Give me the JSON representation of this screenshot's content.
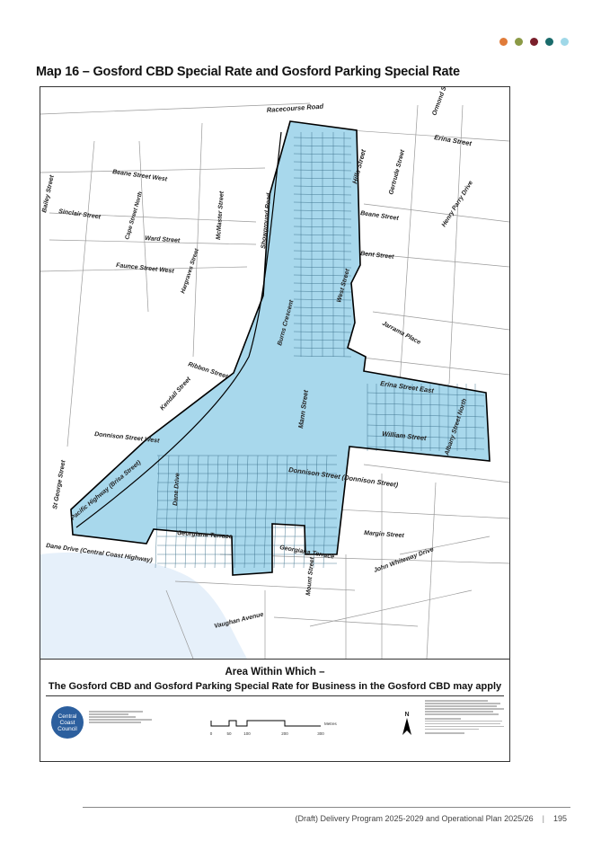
{
  "colors": {
    "dots": [
      "#e07b39",
      "#8b9a46",
      "#7a1f2b",
      "#1a6b6b",
      "#9fd8e8"
    ],
    "rate_area": "#a8d8ec",
    "boundary": "#000000",
    "water": "#e6f0fa",
    "council": "#2c5f9e"
  },
  "map": {
    "title": "Map 16 – Gosford CBD Special Rate and Gosford Parking Special Rate",
    "streets": [
      {
        "id": "racecourse-road",
        "label": "Racecourse Road"
      },
      {
        "id": "erina-street",
        "label": "Erina Street"
      },
      {
        "id": "ormond-street",
        "label": "Ormond Street"
      },
      {
        "id": "hills-street",
        "label": "Hills Street"
      },
      {
        "id": "beane-street-west",
        "label": "Beane Street West"
      },
      {
        "id": "bailey-street",
        "label": "Bailey Street"
      },
      {
        "id": "sinclair-street",
        "label": "Sinclair Street"
      },
      {
        "id": "cape-street-north",
        "label": "Cape Street North"
      },
      {
        "id": "ward-street",
        "label": "Ward Street"
      },
      {
        "id": "faunce-street-west",
        "label": "Faunce Street West"
      },
      {
        "id": "mcmaster-street",
        "label": "McMaster Street"
      },
      {
        "id": "showground-road",
        "label": "Showground Road"
      },
      {
        "id": "hargraves-street",
        "label": "Hargraves Street"
      },
      {
        "id": "gertrude-street",
        "label": "Gertrude Street"
      },
      {
        "id": "henry-parry-drive",
        "label": "Henry Parry Drive"
      },
      {
        "id": "beane-street",
        "label": "Beane Street"
      },
      {
        "id": "bent-street",
        "label": "Bent Street"
      },
      {
        "id": "west-street",
        "label": "West Street"
      },
      {
        "id": "burns-crescent",
        "label": "Burns Crescent"
      },
      {
        "id": "jarrama-place",
        "label": "Jarrama Place"
      },
      {
        "id": "ribbon-street",
        "label": "Ribbon Street"
      },
      {
        "id": "kendall-street",
        "label": "Kendall Street"
      },
      {
        "id": "erina-street-east",
        "label": "Erina Street East"
      },
      {
        "id": "mann-street",
        "label": "Mann Street"
      },
      {
        "id": "donnison-street-west",
        "label": "Donnison Street West"
      },
      {
        "id": "william-street",
        "label": "William Street"
      },
      {
        "id": "albany-street-north",
        "label": "Albany Street North"
      },
      {
        "id": "st-george-street",
        "label": "St George Street"
      },
      {
        "id": "pacific-highway",
        "label": "Pacific Highway (Brisa Street)"
      },
      {
        "id": "donnison-street",
        "label": "Donnison Street (Donnison Street)"
      },
      {
        "id": "dane-drive",
        "label": "Dane Drive"
      },
      {
        "id": "dane-drive-cch",
        "label": "Dane Drive (Central Coast Highway)"
      },
      {
        "id": "georgiana-terrace-w",
        "label": "Georgiana Terrace"
      },
      {
        "id": "georgiana-terrace-e",
        "label": "Georgiana Terrace"
      },
      {
        "id": "margin-street",
        "label": "Margin Street"
      },
      {
        "id": "john-whiteway-drive",
        "label": "John Whiteway Drive"
      },
      {
        "id": "vaughan-avenue",
        "label": "Vaughan Avenue"
      },
      {
        "id": "mount-street",
        "label": "Mount Street"
      }
    ]
  },
  "legend": {
    "line1": "Area Within Which –",
    "line2": "The Gosford CBD and Gosford Parking Special Rate for Business in the Gosford CBD may apply",
    "council_logo": "Central Coast Council",
    "scale_ticks": [
      "0",
      "50",
      "100",
      "200",
      "300"
    ],
    "scale_unit": "Metres",
    "north": "N"
  },
  "footer": {
    "text": "(Draft) Delivery Program 2025-2029 and Operational Plan 2025/26",
    "page": "195"
  }
}
